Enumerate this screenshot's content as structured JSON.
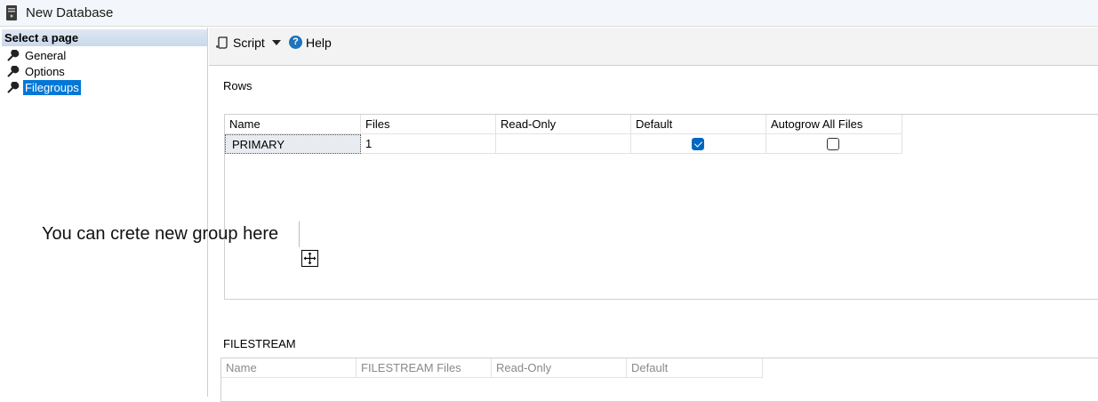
{
  "window": {
    "title": "New Database"
  },
  "left_pane": {
    "header": "Select a page",
    "items": [
      {
        "label": "General",
        "selected": false
      },
      {
        "label": "Options",
        "selected": false
      },
      {
        "label": "Filegroups",
        "selected": true
      }
    ]
  },
  "toolbar": {
    "script_label": "Script",
    "help_label": "Help"
  },
  "rows_section": {
    "label": "Rows",
    "columns": [
      "Name",
      "Files",
      "Read-Only",
      "Default",
      "Autogrow All Files"
    ],
    "rows": [
      {
        "name": "PRIMARY",
        "files": "1",
        "read_only": "",
        "default": true,
        "autogrow_all_files": false
      }
    ]
  },
  "filestream_section": {
    "label": "FILESTREAM",
    "columns": [
      "Name",
      "FILESTREAM Files",
      "Read-Only",
      "Default"
    ]
  },
  "annotation": {
    "text": "You can crete new group here"
  },
  "colors": {
    "selection": "#0078d7",
    "checkbox_checked": "#0067c0"
  }
}
